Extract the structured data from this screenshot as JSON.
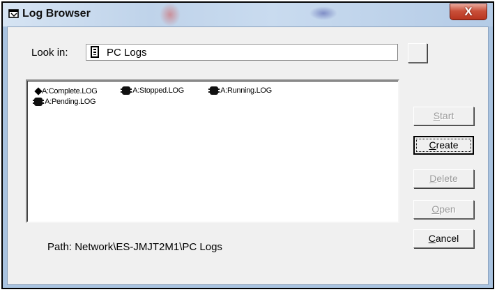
{
  "window": {
    "title": "Log Browser",
    "close_glyph": "X"
  },
  "look_in": {
    "label": "Look in:",
    "value": "PC Logs",
    "icon": "folder-list-icon"
  },
  "files": [
    {
      "name": "A:Complete.LOG",
      "status": "complete",
      "icon": "diamond-icon"
    },
    {
      "name": "A:Stopped.LOG",
      "status": "stopped",
      "icon": "bug-icon"
    },
    {
      "name": "A:Running.LOG",
      "status": "running",
      "icon": "bug-icon"
    },
    {
      "name": "A:Pending.LOG",
      "status": "pending",
      "icon": "bug-icon"
    }
  ],
  "buttons": {
    "start": {
      "mnemonic": "S",
      "rest": "tart",
      "enabled": false
    },
    "create": {
      "mnemonic": "C",
      "rest": "reate",
      "enabled": true,
      "default": true
    },
    "delete": {
      "mnemonic": "D",
      "rest": "elete",
      "enabled": false
    },
    "open": {
      "mnemonic": "O",
      "rest": "pen",
      "enabled": false
    },
    "cancel": {
      "mnemonic": "C",
      "rest": "ancel",
      "enabled": true
    }
  },
  "path": {
    "text": "Path:  Network\\ES-JMJT2M1\\PC Logs"
  },
  "colors": {
    "close_button": "#c9503a",
    "dialog_background": "#f0f0f0",
    "disabled_text": "#9a9a9a"
  }
}
